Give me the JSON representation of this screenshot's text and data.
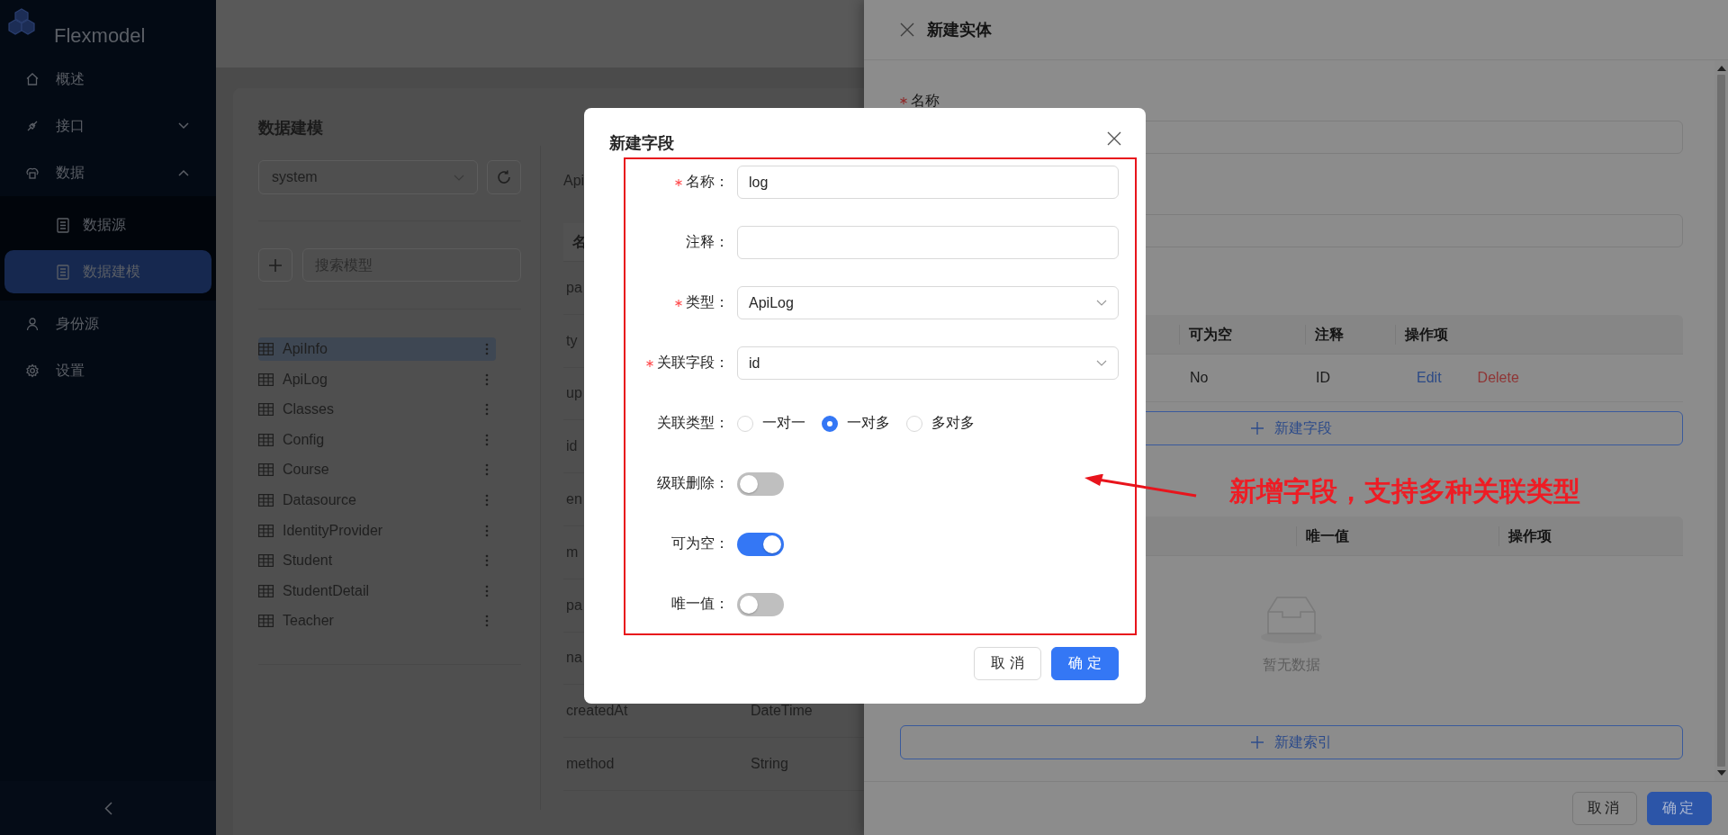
{
  "sidebar": {
    "brand": "Flexmodel",
    "items": [
      {
        "label": "概述",
        "selected": false
      },
      {
        "label": "接口",
        "selected": false,
        "expanded": false
      },
      {
        "label": "数据",
        "selected": false,
        "expanded": true,
        "children": [
          {
            "label": "数据源",
            "selected": false
          },
          {
            "label": "数据建模",
            "selected": true
          }
        ]
      },
      {
        "label": "身份源",
        "selected": false
      },
      {
        "label": "设置",
        "selected": false
      }
    ]
  },
  "data_modeling": {
    "title": "数据建模",
    "datasource_select": {
      "value": "system"
    },
    "search": {
      "placeholder": "搜索模型"
    },
    "models": [
      {
        "label": "ApiInfo",
        "selected": true
      },
      {
        "label": "ApiLog",
        "selected": false
      },
      {
        "label": "Classes",
        "selected": false
      },
      {
        "label": "Config",
        "selected": false
      },
      {
        "label": "Course",
        "selected": false
      },
      {
        "label": "Datasource",
        "selected": false
      },
      {
        "label": "IdentityProvider",
        "selected": false
      },
      {
        "label": "Student",
        "selected": false
      },
      {
        "label": "StudentDetail",
        "selected": false
      },
      {
        "label": "Teacher",
        "selected": false
      }
    ]
  },
  "model_fields": {
    "caption": "Api",
    "columns": [
      "名"
    ],
    "rows": [
      {
        "name": "pa"
      },
      {
        "name": "ty"
      },
      {
        "name": "up"
      },
      {
        "name": "id"
      },
      {
        "name": "en"
      },
      {
        "name": "m"
      },
      {
        "name": "pa"
      },
      {
        "name": "na"
      },
      {
        "name": "createdAt",
        "type": "DateTime"
      },
      {
        "name": "method",
        "type": "String"
      }
    ]
  },
  "drawer": {
    "title": "新建实体",
    "fields": [
      {
        "label": "名称",
        "required": true
      }
    ],
    "fields_table": {
      "columns": [
        "可为空",
        "注释",
        "操作项"
      ],
      "rows": [
        {
          "cells": [
            "No",
            "ID"
          ],
          "actions": [
            {
              "label": "Edit",
              "kind": "edit"
            },
            {
              "label": "Delete",
              "kind": "delete"
            }
          ]
        }
      ]
    },
    "add_field_button": "新建字段",
    "index_table": {
      "columns": [
        "唯一值",
        "操作项"
      ],
      "empty_text": "暂无数据"
    },
    "add_index_button": "新建索引",
    "buttons": [
      {
        "label": "取消",
        "kind": "default"
      },
      {
        "label": "确定",
        "kind": "primary"
      }
    ]
  },
  "dialog": {
    "title": "新建字段",
    "fields": [
      {
        "kind": "input",
        "label": "名称：",
        "required": true,
        "value": "log"
      },
      {
        "kind": "input",
        "label": "注释：",
        "required": false
      },
      {
        "kind": "select",
        "label": "类型：",
        "required": true,
        "value": "ApiLog"
      },
      {
        "kind": "select",
        "label": "关联字段：",
        "required": true,
        "value": "id"
      },
      {
        "kind": "radio",
        "label": "关联类型：",
        "required": false,
        "options": [
          {
            "label": "一对一",
            "selected": false
          },
          {
            "label": "一对多",
            "selected": true
          },
          {
            "label": "多对多",
            "selected": false
          }
        ]
      },
      {
        "kind": "switch",
        "label": "级联删除：",
        "required": false,
        "on": false
      },
      {
        "kind": "switch",
        "label": "可为空：",
        "required": false,
        "on": true
      },
      {
        "kind": "switch",
        "label": "唯一值：",
        "required": false,
        "on": false
      }
    ],
    "buttons": [
      {
        "label": "取 消",
        "kind": "default"
      },
      {
        "label": "确 定",
        "kind": "primary"
      }
    ]
  },
  "annotation": {
    "text": "新增字段，支持多种关联类型"
  }
}
